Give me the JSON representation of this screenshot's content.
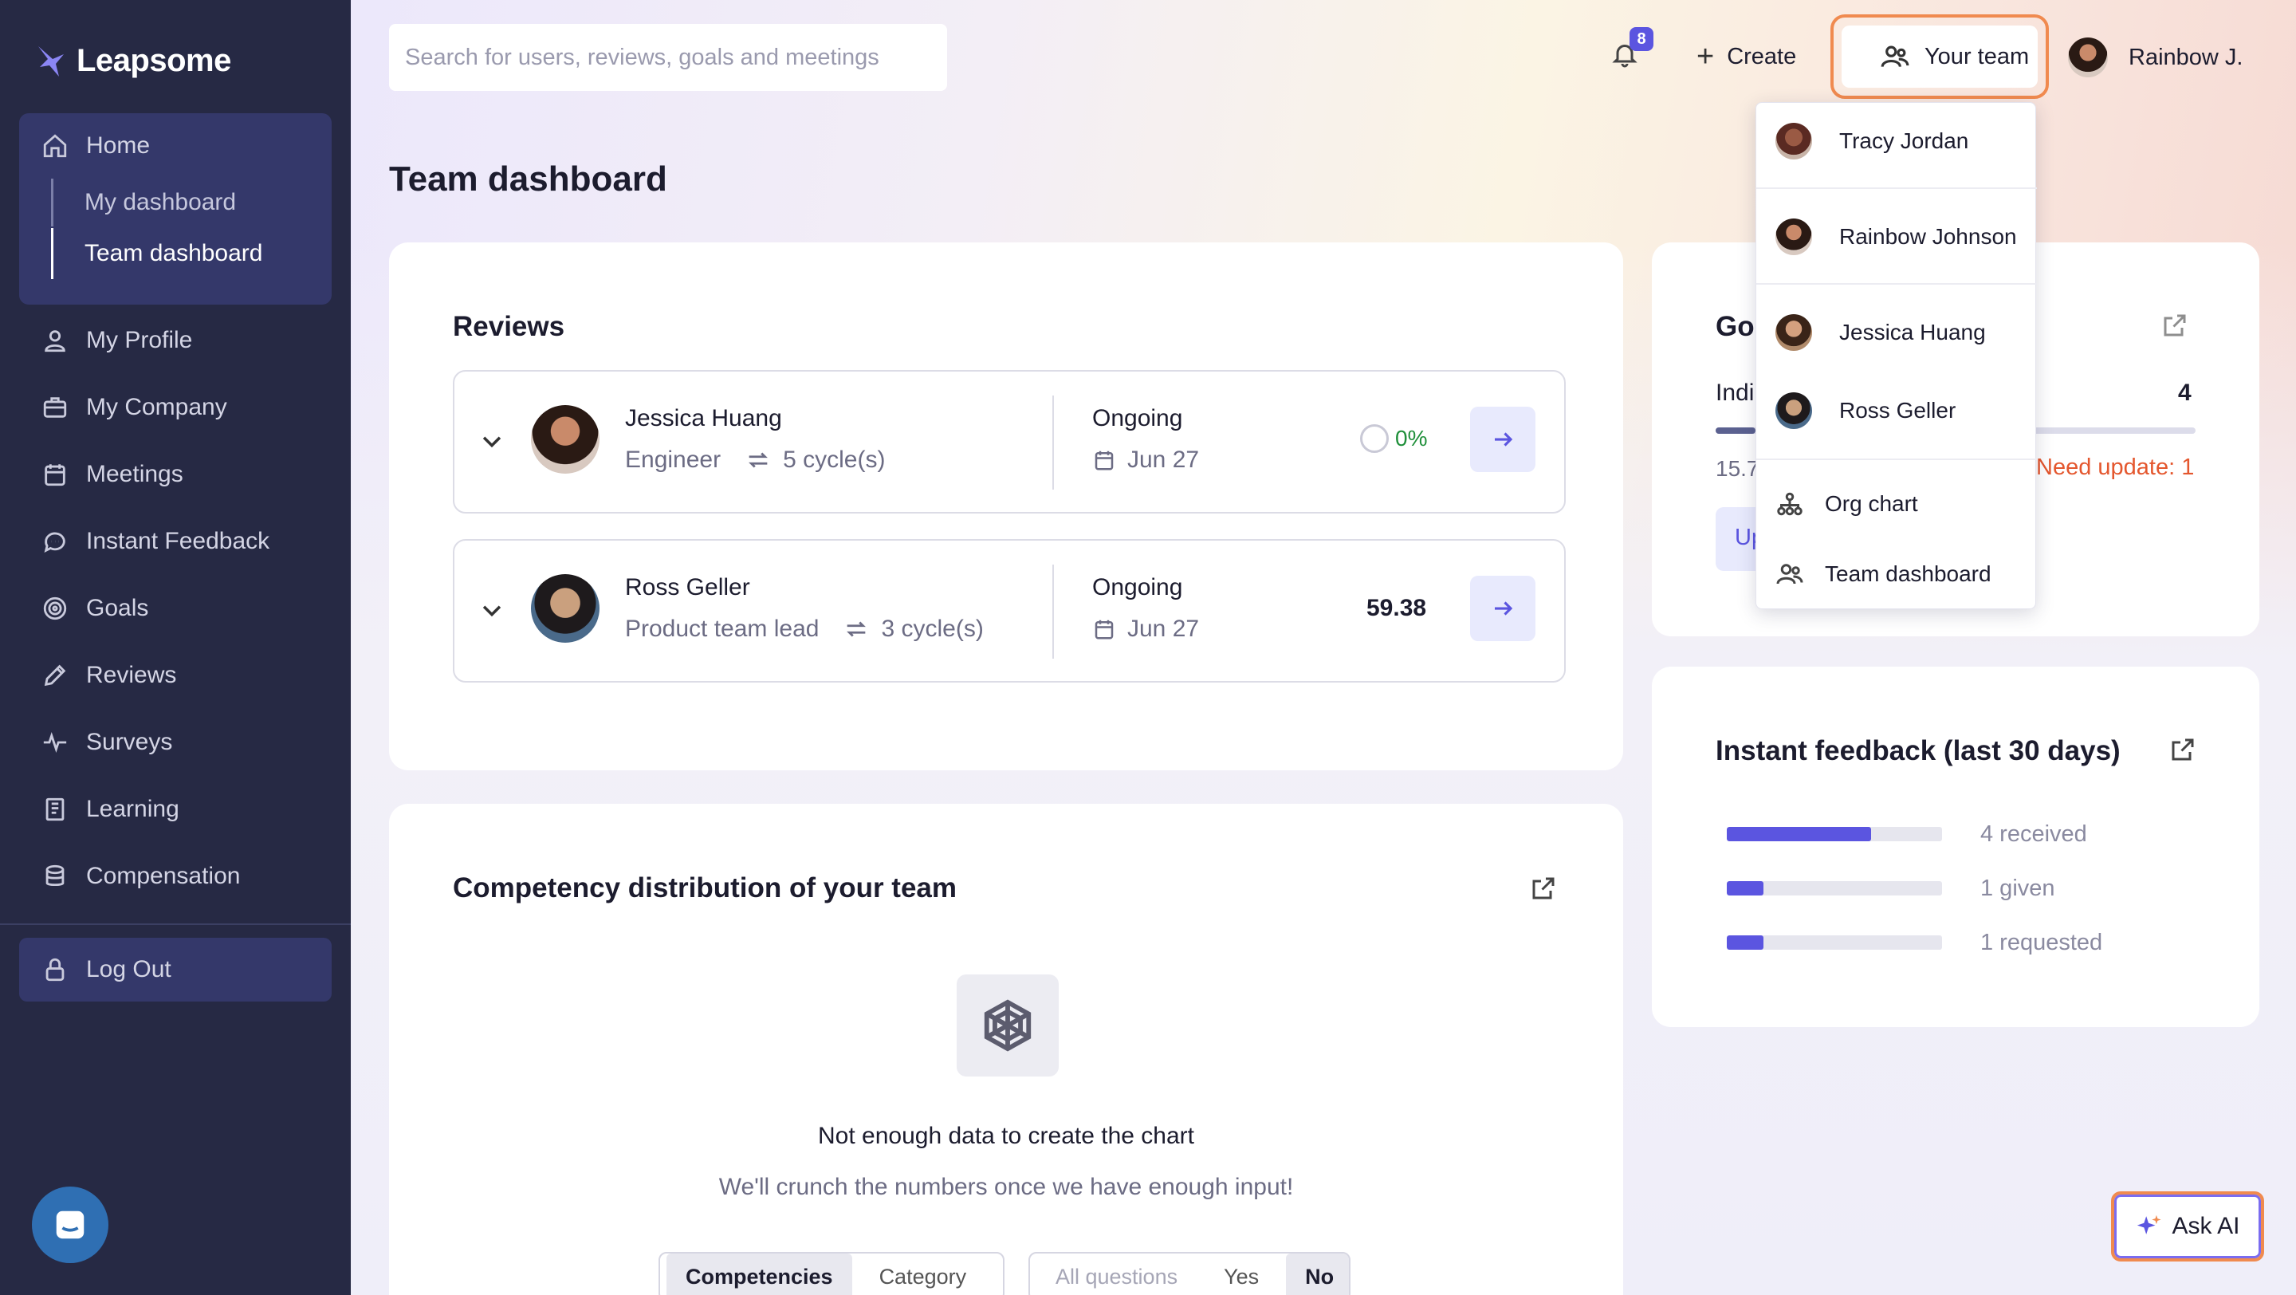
{
  "app": {
    "brand": "Leapsome",
    "title": "Team dashboard"
  },
  "sidebar": {
    "home": "Home",
    "sub_items": [
      "My dashboard",
      "Team dashboard"
    ],
    "items": [
      "My Profile",
      "My Company",
      "Meetings",
      "Instant Feedback",
      "Goals",
      "Reviews",
      "Surveys",
      "Learning",
      "Compensation"
    ],
    "logout": "Log Out"
  },
  "header": {
    "search_placeholder": "Search for users, reviews, goals and meetings",
    "notifications_count": "8",
    "create_label": "Create",
    "your_team_label": "Your team",
    "user_name": "Rainbow J."
  },
  "reviews": {
    "title": "Reviews",
    "rows": [
      {
        "name": "Jessica Huang",
        "role": "Engineer",
        "cycles": "5 cycle(s)",
        "status": "Ongoing",
        "date": "Jun 27",
        "progress": "0%"
      },
      {
        "name": "Ross Geller",
        "role": "Product team lead",
        "cycles": "3 cycle(s)",
        "status": "Ongoing",
        "date": "Jun 27",
        "score": "59.38"
      }
    ]
  },
  "competency": {
    "title": "Competency distribution of your team",
    "empty_title": "Not enough data to create the chart",
    "empty_sub": "We'll crunch the numbers once we have enough input!",
    "toggle_a": [
      "Competencies",
      "Category"
    ],
    "toggle_b": [
      "All questions",
      "Yes",
      "No"
    ]
  },
  "goals": {
    "title_partial": "Go",
    "row_label_partial": "Indi",
    "row_value": "4",
    "stat_partial": "15.7",
    "need_update": "Need update: 1",
    "button_partial": "Up"
  },
  "feedback": {
    "title": "Instant feedback (last 30 days)",
    "rows": [
      {
        "label": "4 received",
        "fraction": 0.67
      },
      {
        "label": "1 given",
        "fraction": 0.17
      },
      {
        "label": "1 requested",
        "fraction": 0.17
      }
    ]
  },
  "team_menu": {
    "people": [
      "Tracy Jordan",
      "Rainbow Johnson",
      "Jessica Huang",
      "Ross Geller"
    ],
    "links": [
      "Org chart",
      "Team dashboard"
    ]
  },
  "ask_ai": "Ask AI",
  "colors": {
    "sidebar_bg": "#262944",
    "accent": "#5b55e0",
    "highlight_orange": "#f08a4f",
    "success": "#1f8f3a",
    "warning": "#e4572e"
  }
}
